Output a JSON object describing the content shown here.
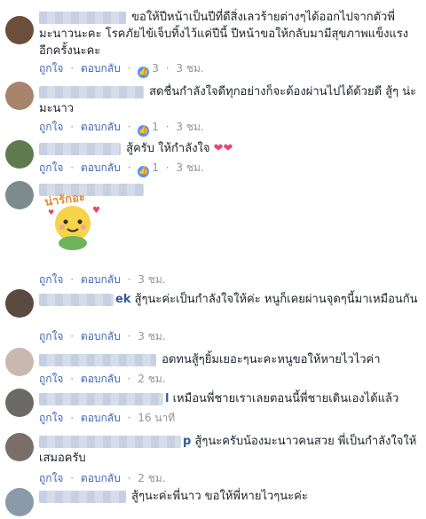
{
  "actions": {
    "like": "ถูกใจ",
    "reply": "ตอบกลับ",
    "dot": "·"
  },
  "comments": [
    {
      "name_tail": "",
      "text": "ขอให้ปีหน้าเป็นปีที่ดีสิ่งเลวร้ายต่างๆได้ออกไปจากตัวพี่มะนาวนะคะ โรคภัยไข้เจ็บทิ้งไว้แค่ปีนี้ ปีหน้าขอให้กลับมามีสุขภาพแข็งแรงอีกครั้งนะคะ",
      "likes": "3",
      "time": "3 ชม."
    },
    {
      "name_tail": "",
      "text": "สดชื่นกำลังใจดีทุกอย่างก็จะต้องผ่านไปได้ด้วยดี สู้ๆ น่ะมะนาว",
      "likes": "1",
      "time": "3 ชม."
    },
    {
      "name_tail": "",
      "text": "สู้ครับ ให้กำลังใจ",
      "likes": "1",
      "time": "3 ชม.",
      "hearts": "❤❤"
    },
    {
      "name_tail": "",
      "sticker_text": "น่ารักอะ",
      "time": "3 ชม."
    },
    {
      "name_tail": "ek",
      "text": "สู้ๆนะค่ะเป็นกำลังใจให้ค่ะ หนูก็เคยผ่านจุดๆนี้มาเหมือนกัน",
      "time": "3 ชม."
    },
    {
      "name_tail": "",
      "text": "อดทนสู้ๆยิ้มเยอะๆนะคะหนูขอให้หายไวไวค่า",
      "time": "2 ชม."
    },
    {
      "name_tail": "l",
      "text": "เหมือนพี่ชายเราเลยตอนนี้พี่ชายเดินเองได้แล้ว",
      "time": "16 นาที"
    },
    {
      "name_tail": "p",
      "text": "สู้ๆนะครับน้องมะนาวคนสวย พี่เป็นกำลังใจให้เสมอครับ",
      "time": "2 ชม."
    },
    {
      "name_tail": "",
      "text": "สู้ๆนะค่ะพี่นาว ขอให้พี่หายไวๆนะค่ะ",
      "time": ""
    }
  ],
  "colors": {
    "link": "#4267b2",
    "meta": "#90949c",
    "name": "#365899",
    "like_badge": "#5890ff",
    "heart": "#e5496b"
  }
}
